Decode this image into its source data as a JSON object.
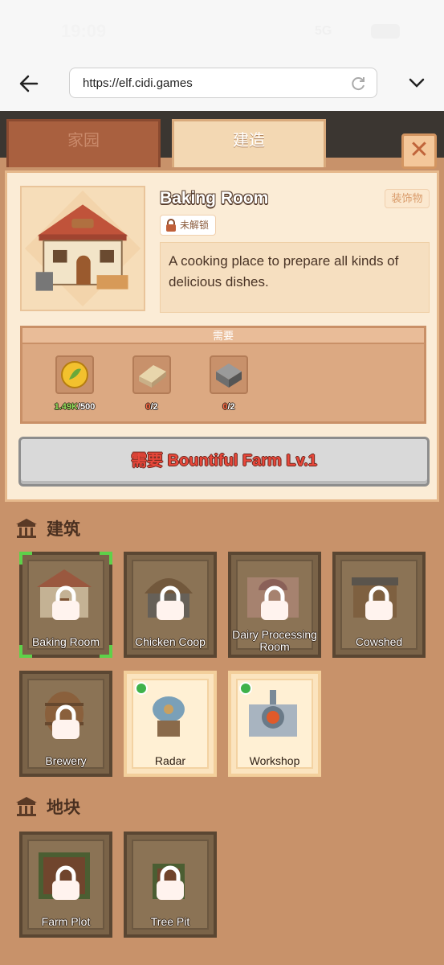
{
  "status": {
    "time": "19:09",
    "network": "5G"
  },
  "browser": {
    "url": "https://elf.cidi.games"
  },
  "tabs": [
    {
      "label": "家园"
    },
    {
      "label": "建造"
    }
  ],
  "detail": {
    "title": "Baking Room",
    "category_tag": "装饰物",
    "lock_status": "未解锁",
    "description": "A cooking place to prepare all kinds of delicious dishes.",
    "requirements_header": "需要",
    "requirements": [
      {
        "icon": "coin-icon",
        "have": "1.49K",
        "need": "/500",
        "have_color": "green"
      },
      {
        "icon": "wood-plank-icon",
        "have": "0",
        "need": "/2",
        "have_color": "red"
      },
      {
        "icon": "stone-block-icon",
        "have": "0",
        "need": "/2",
        "have_color": "red"
      }
    ],
    "unlock_button": "需要 Bountiful Farm Lv.1"
  },
  "sections": [
    {
      "title": "建筑",
      "items": [
        {
          "label": "Baking Room",
          "locked": true,
          "selected": true
        },
        {
          "label": "Chicken Coop",
          "locked": true
        },
        {
          "label": "Dairy Processing Room",
          "locked": true
        },
        {
          "label": "Cowshed",
          "locked": true
        },
        {
          "label": "Brewery",
          "locked": true
        },
        {
          "label": "Radar",
          "locked": false
        },
        {
          "label": "Workshop",
          "locked": false
        }
      ]
    },
    {
      "title": "地块",
      "items": [
        {
          "label": "Farm Plot",
          "locked": true
        },
        {
          "label": "Tree Pit",
          "locked": true
        }
      ]
    }
  ],
  "colors": {
    "game_bg": "#c8926a",
    "panel_bg": "#fbecd6",
    "accent_red": "#e8473a",
    "select_green": "#5ed149"
  }
}
